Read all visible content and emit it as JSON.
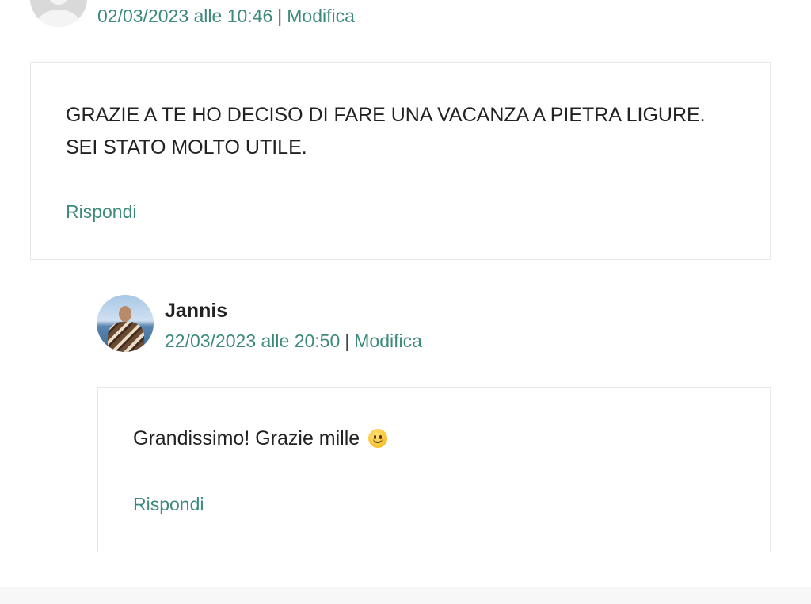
{
  "comments": [
    {
      "date": "02/03/2023 alle 10:46",
      "separator": "|",
      "edit_label": "Modifica",
      "text_line_1": "GRAZIE A TE HO DECISO DI FARE UNA VACANZA A PIETRA LIGURE.",
      "text_line_2": "SEI STATO MOLTO UTILE.",
      "reply_label": "Rispondi"
    },
    {
      "author": "Jannis",
      "date": "22/03/2023 alle 20:50",
      "separator": "|",
      "edit_label": "Modifica",
      "text": "Grandissimo! Grazie mille",
      "emoji": "slightly-smiling-face-icon",
      "reply_label": "Rispondi"
    }
  ],
  "colors": {
    "link": "#3d8a7c",
    "text": "#222222",
    "border": "#e8e8e8"
  }
}
